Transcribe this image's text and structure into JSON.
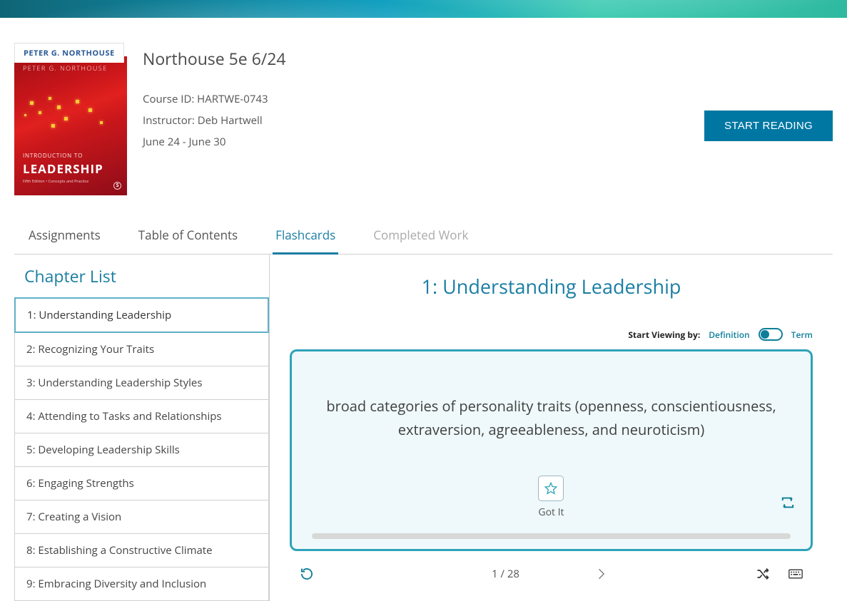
{
  "book": {
    "author_tab": "PETER G. NORTHOUSE",
    "cover_author": "PETER G. NORTHOUSE",
    "cover_intro": "INTRODUCTION TO",
    "cover_title": "LEADERSHIP",
    "cover_sub": "Fifth Edition • Concepts and Practice"
  },
  "course": {
    "title": "Northouse 5e 6/24",
    "id_label": "Course ID: HARTWE-0743",
    "instructor": "Instructor: Deb Hartwell",
    "dates": "June 24 - June 30"
  },
  "cta": {
    "start": "START READING"
  },
  "tabs": {
    "assignments": "Assignments",
    "toc": "Table of Contents",
    "flashcards": "Flashcards",
    "completed": "Completed Work"
  },
  "sidebar": {
    "heading": "Chapter List",
    "chapters": [
      "1: Understanding Leadership",
      "2: Recognizing Your Traits",
      "3: Understanding Leadership Styles",
      "4: Attending to Tasks and Relationships",
      "5: Developing Leadership Skills",
      "6: Engaging Strengths",
      "7: Creating a Vision",
      "8: Establishing a Constructive Climate",
      "9: Embracing Diversity and Inclusion"
    ]
  },
  "flashcard": {
    "title": "1: Understanding Leadership",
    "view_label": "Start Viewing by:",
    "opt_def": "Definition",
    "opt_term": "Term",
    "card_text": "broad categories of personality traits (openness, conscientiousness, extraversion, agreeableness, and neuroticism)",
    "gotit": "Got It",
    "counter": "1 / 28"
  }
}
